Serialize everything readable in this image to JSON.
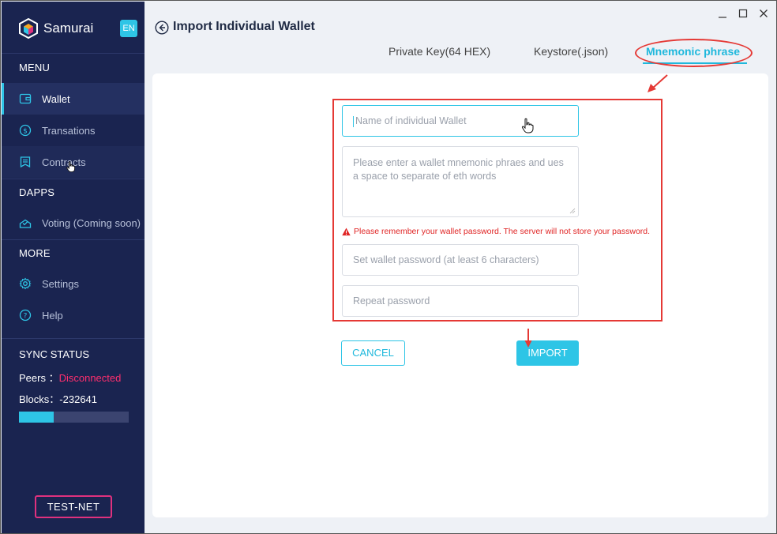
{
  "app": {
    "name": "Samurai",
    "language": "EN"
  },
  "sidebar": {
    "menu_title": "MENU",
    "items": [
      {
        "label": "Wallet",
        "icon": "wallet-icon",
        "active": true
      },
      {
        "label": "Transations",
        "icon": "dollar-icon"
      },
      {
        "label": "Contracts",
        "icon": "contract-icon"
      }
    ],
    "dapps_title": "DAPPS",
    "dapps": [
      {
        "label": "Voting (Coming soon)",
        "icon": "voting-icon"
      }
    ],
    "more_title": "MORE",
    "more": [
      {
        "label": "Settings",
        "icon": "gear-icon"
      },
      {
        "label": "Help",
        "icon": "help-icon"
      }
    ],
    "sync": {
      "title": "SYNC STATUS",
      "peers_label": "Peers ：",
      "peers_value": "Disconnected",
      "blocks_label": "Blocks：",
      "blocks_value": "-232641",
      "progress": 0.32
    },
    "network": "TEST-NET"
  },
  "header": {
    "title": "Import Individual Wallet",
    "tabs": [
      {
        "label": "Private Key(64 HEX)"
      },
      {
        "label": "Keystore(.json)"
      },
      {
        "label": "Mnemonic phrase",
        "active": true
      }
    ]
  },
  "form": {
    "wallet_name_placeholder": "Name of individual Wallet",
    "mnemonic_placeholder": "Please enter a wallet mnemonic phraes and ues a space to separate of eth words",
    "warning": "Please remember your wallet password. The server will not store your password.",
    "password_placeholder": "Set wallet password (at least 6 characters)",
    "repeat_placeholder": "Repeat password",
    "cancel_label": "CANCEL",
    "import_label": "IMPORT"
  },
  "colors": {
    "accent": "#2ec5e6",
    "sidebar_bg": "#1a2450",
    "danger": "#e02424",
    "annotation": "#e53935"
  }
}
